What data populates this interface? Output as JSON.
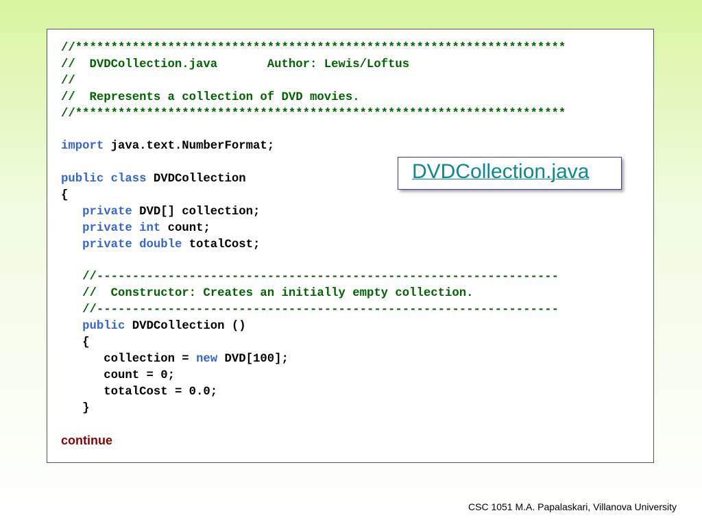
{
  "code": {
    "header_border_top": "//*********************************************************************",
    "header_file_line": "//  DVDCollection.java       Author: Lewis/Loftus",
    "header_blank_comment": "//",
    "header_desc_line": "//  Represents a collection of DVD movies.",
    "header_border_bottom": "//*********************************************************************",
    "import_keyword": "import",
    "import_rest": " java.text.NumberFormat;",
    "class_public": "public",
    "class_class": "class",
    "class_name": " DVDCollection",
    "open_brace": "{",
    "field1_private": "private",
    "field1_rest": " DVD[] collection;",
    "field2_private": "private",
    "field2_int": "int",
    "field2_rest": " count;",
    "field3_private": "private",
    "field3_double": "double",
    "field3_rest": " totalCost;",
    "ctor_comment_top": "//-----------------------------------------------------------------",
    "ctor_comment_desc": "//  Constructor: Creates an initially empty collection.",
    "ctor_comment_bottom": "//-----------------------------------------------------------------",
    "ctor_public": "public",
    "ctor_rest": " DVDCollection ()",
    "ctor_open": "{",
    "stmt1_lhs": "collection = ",
    "stmt1_new": "new",
    "stmt1_rest": " DVD[100];",
    "stmt2": "count = 0;",
    "stmt3": "totalCost = 0.0;",
    "ctor_close": "}"
  },
  "continue_label": "continue",
  "file_link_label": "DVDCollection.java ",
  "footer_text": "CSC 1051 M.A. Papalaskari, Villanova University",
  "colors": {
    "comment": "#006400",
    "keyword": "#3465d6",
    "continue": "#8b0000",
    "link": "#0a8a8a"
  }
}
